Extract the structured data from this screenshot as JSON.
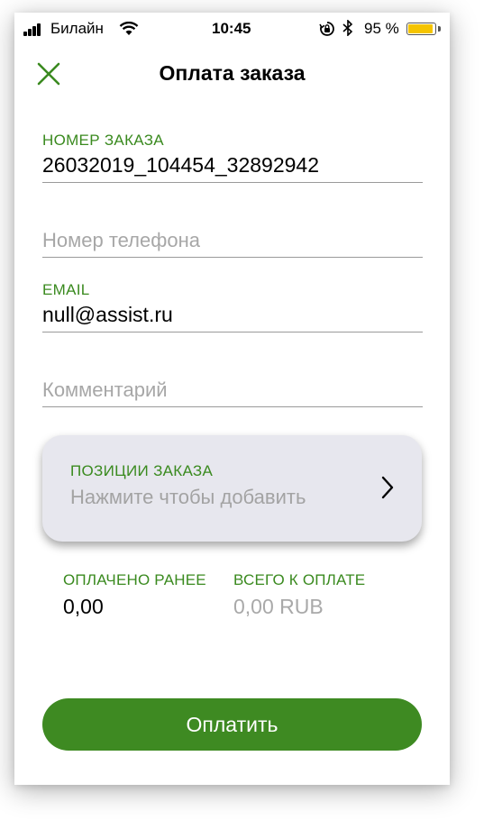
{
  "status_bar": {
    "carrier": "Билайн",
    "time": "10:45",
    "battery_percent_text": "95 %",
    "battery_level": 0.95,
    "icons": [
      "signal-icon",
      "wifi-icon",
      "orientation-lock-icon",
      "bluetooth-icon",
      "battery-icon"
    ]
  },
  "nav": {
    "title": "Оплата заказа",
    "close_icon": "close-icon"
  },
  "form": {
    "order_number": {
      "label": "НОМЕР ЗАКАЗА",
      "value": "26032019_104454_32892942"
    },
    "phone": {
      "placeholder": "Номер телефона"
    },
    "email": {
      "label": "EMAIL",
      "value": "null@assist.ru"
    },
    "comment": {
      "placeholder": "Комментарий"
    }
  },
  "order_items": {
    "label": "ПОЗИЦИИ ЗАКАЗА",
    "hint": "Нажмите чтобы добавить",
    "icon": "chevron-right-icon"
  },
  "totals": {
    "paid_label": "ОПЛАЧЕНО РАНЕЕ",
    "paid_value": "0,00",
    "total_label": "ВСЕГО К ОПЛАТЕ",
    "total_value": "0,00 RUB"
  },
  "actions": {
    "pay_label": "Оплатить"
  },
  "colors": {
    "accent_green": "#3a8a1f",
    "button_green": "#3e8a22",
    "card_background": "#e7e7ee",
    "placeholder_gray": "#a7a7a7"
  }
}
